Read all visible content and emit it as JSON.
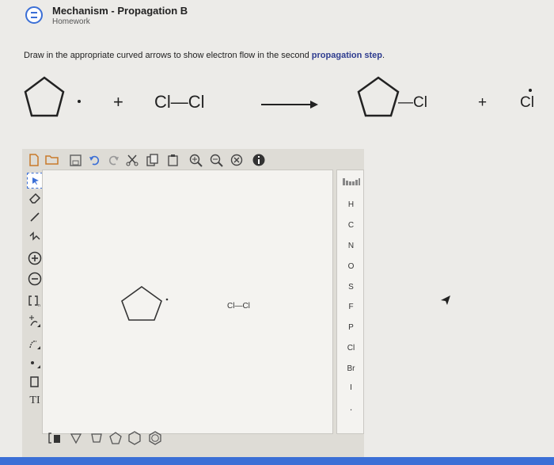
{
  "header": {
    "title": "Mechanism - Propagation B",
    "subtitle": "Homework"
  },
  "instruction": {
    "text": "Draw in the appropriate curved arrows to show electron flow in the second ",
    "emphasis": "propagation step",
    "end": "."
  },
  "reaction": {
    "plus1": "+",
    "reagent": "Cl—Cl",
    "plus2": "+",
    "product_cl": "—Cl",
    "radical": "Cl"
  },
  "editor": {
    "canvas_molecule_label": "Cl—Cl",
    "elements": [
      "H",
      "C",
      "N",
      "O",
      "S",
      "F",
      "P",
      "Cl",
      "Br",
      "I"
    ],
    "text_tool": "TI",
    "left_tools": [
      "select-lasso-icon",
      "eraser-icon",
      "single-bond-icon",
      "chain-icon",
      "positive-charge-icon",
      "negative-charge-icon",
      "brackets-icon",
      "curved-arrow-icon",
      "electron-arrow-icon",
      "lone-pair-icon",
      "rectangle-icon",
      "text-tool-icon"
    ],
    "top_tools": [
      "new-doc-icon",
      "open-icon",
      "save-icon",
      "undo-icon",
      "redo-icon",
      "cut-icon",
      "copy-icon",
      "paste-icon",
      "zoom-in-icon",
      "zoom-out-icon",
      "clear-icon",
      "info-icon"
    ],
    "ring_templates": [
      "cyclopropane",
      "cyclobutane",
      "cyclopentane",
      "cyclohexane",
      "benzene"
    ]
  },
  "colors": {
    "accent": "#3b6fd6",
    "emphasis": "#2e3c8f",
    "background": "#ecebe8"
  }
}
